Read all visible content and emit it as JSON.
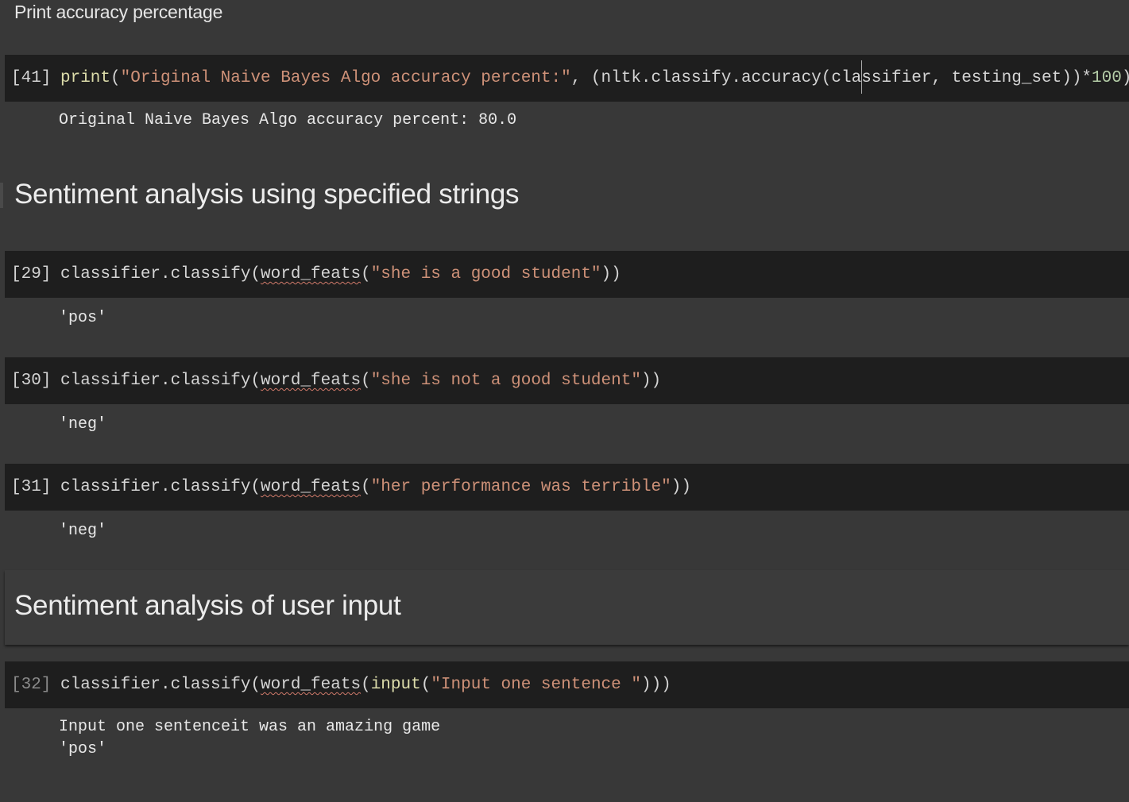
{
  "markdown": {
    "intro": "Print accuracy percentage",
    "heading1": "Sentiment analysis using specified strings",
    "heading2": "Sentiment analysis of user input"
  },
  "cells": [
    {
      "exec": "[41]",
      "code": {
        "fn": "print",
        "open": "(",
        "str": "\"Original Naive Bayes Algo accuracy percent:\"",
        "mid1": ", (nltk.classify.accuracy(cla",
        "mid2": "ssifier, testing_set))*",
        "num": "100",
        "close": ")"
      },
      "output": "Original Naive Bayes Algo accuracy percent: 80.0"
    },
    {
      "exec": "[29]",
      "code": {
        "pre": "classifier.classify(",
        "fn": "word_feats",
        "open": "(",
        "str": "\"she is a good student\"",
        "close": "))"
      },
      "output": "'pos'"
    },
    {
      "exec": "[30]",
      "code": {
        "pre": "classifier.classify(",
        "fn": "word_feats",
        "open": "(",
        "str": "\"she is not a good student\"",
        "close": "))"
      },
      "output": "'neg'"
    },
    {
      "exec": "[31]",
      "code": {
        "pre": "classifier.classify(",
        "fn": "word_feats",
        "open": "(",
        "str": "\"her performance was terrible\"",
        "close": "))"
      },
      "output": "'neg'"
    },
    {
      "exec": "[32]",
      "code": {
        "pre": "classifier.classify(",
        "fn": "word_feats",
        "open": "(",
        "fn2": "input",
        "open2": "(",
        "str": "\"Input one sentence \"",
        "close": ")))"
      },
      "output_line1": "Input one sentenceit was an amazing game",
      "output_line2": "'pos'"
    }
  ]
}
